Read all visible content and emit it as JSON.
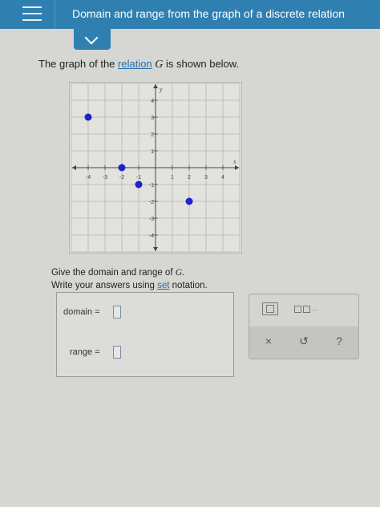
{
  "header": {
    "title": "Domain and range from the graph of a discrete relation"
  },
  "problem": {
    "prompt_before": "The graph of the ",
    "relation_link": "relation",
    "variable": "G",
    "prompt_after": " is shown below.",
    "instruction_line1_before": "Give the domain and range of ",
    "instruction_line1_after": ".",
    "instruction_line2_before": "Write your answers using ",
    "set_link": "set",
    "instruction_line2_after": " notation."
  },
  "answer": {
    "domain_label": "domain =",
    "range_label": "range ="
  },
  "keypad": {
    "list_dots": "...",
    "clear_symbol": "×",
    "undo_symbol": "↺",
    "help_symbol": "?"
  },
  "graph": {
    "x_axis_label": "x",
    "y_axis_label": "y",
    "x_ticks": [
      -4,
      -3,
      -2,
      -1,
      1,
      2,
      3,
      4
    ],
    "y_ticks": [
      4,
      3,
      2,
      1,
      -1,
      -2,
      -3,
      -4
    ],
    "x_range": [
      -5,
      5
    ],
    "y_range": [
      -5,
      5
    ],
    "points": [
      {
        "x": -4,
        "y": 3
      },
      {
        "x": -2,
        "y": 0
      },
      {
        "x": -1,
        "y": -1
      },
      {
        "x": 2,
        "y": -2
      }
    ],
    "point_color": "#1f23c8"
  }
}
